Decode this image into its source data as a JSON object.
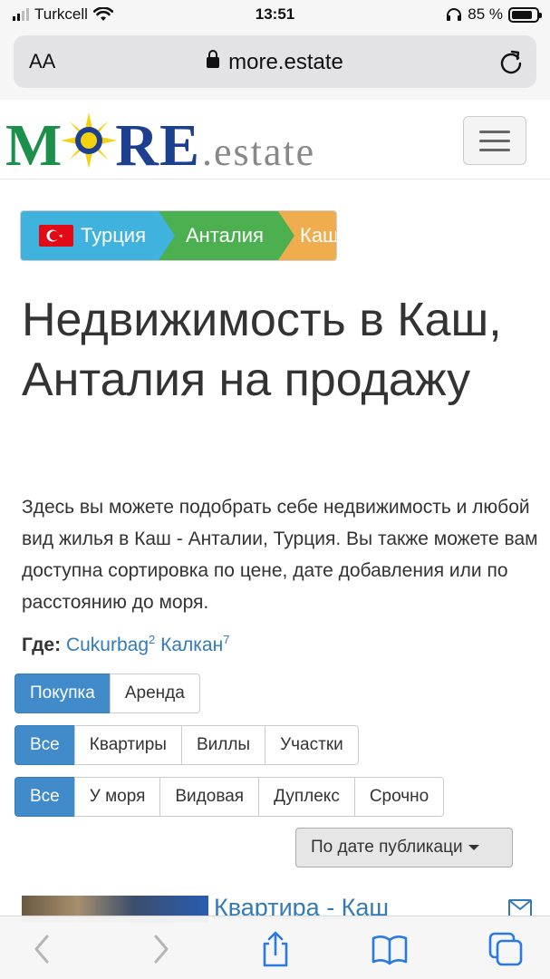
{
  "status_bar": {
    "carrier": "Turkcell",
    "time": "13:51",
    "battery": "85 %"
  },
  "browser": {
    "text_size_label": "AA",
    "url": "more.estate"
  },
  "site": {
    "logo_main": "MORE",
    "logo_suffix": ".estate"
  },
  "breadcrumb": [
    {
      "label": "Турция"
    },
    {
      "label": "Анталия"
    },
    {
      "label": "Каш"
    }
  ],
  "page": {
    "title": "Недвижимость в Каш, Анталия на продажу",
    "description": "Здесь вы можете подобрать себе недвижимость и любой вид жилья в Каш - Анталии, Турция. Вы также можете вам доступна сортировка по цене, дате добавления или по расстоянию до моря.",
    "where_label": "Где:",
    "locations": [
      {
        "name": "Cukurbag",
        "count": "2"
      },
      {
        "name": "Калкан",
        "count": "7"
      }
    ]
  },
  "filters": {
    "deal_type": [
      "Покупка",
      "Аренда"
    ],
    "property_type": [
      "Все",
      "Квартиры",
      "Виллы",
      "Участки"
    ],
    "feature": [
      "Все",
      "У моря",
      "Видовая",
      "Дуплекс",
      "Срочно"
    ],
    "sort_label": "По дате публикаци"
  },
  "listing_preview": {
    "title": "Квартира - Каш"
  },
  "colors": {
    "primary": "#428bca",
    "crumb_turkey": "#3fb3de",
    "crumb_antalya": "#4caf50",
    "crumb_kas": "#f0ad4e",
    "link": "#337ab7"
  }
}
